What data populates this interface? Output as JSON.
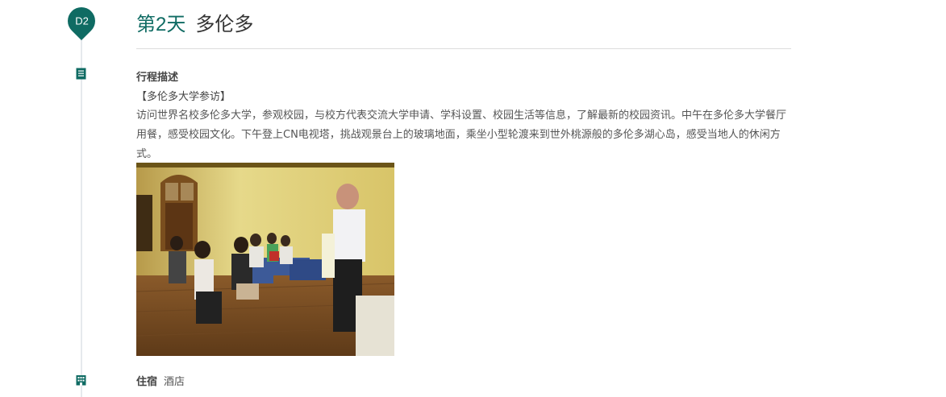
{
  "day": {
    "badge": "D2",
    "label": "第2天",
    "city": "多伦多"
  },
  "itinerary": {
    "section_label": "行程描述",
    "subtitle": "【多伦多大学参访】",
    "description": "访问世界名校多伦多大学，参观校园，与校方代表交流大学申请、学科设置、校园生活等信息，了解最新的校园资讯。中午在多伦多大学餐厅用餐，感受校园文化。下午登上CN电视塔，挑战观景台上的玻璃地面，乘坐小型轮渡来到世外桃源般的多伦多湖心岛，感受当地人的休闲方式。"
  },
  "lodging": {
    "label": "住宿",
    "value": "酒店"
  },
  "colors": {
    "accent": "#0f6b63",
    "timeline": "#e6e9ed"
  },
  "icons": {
    "itinerary": "document-list-icon",
    "lodging": "building-icon"
  }
}
